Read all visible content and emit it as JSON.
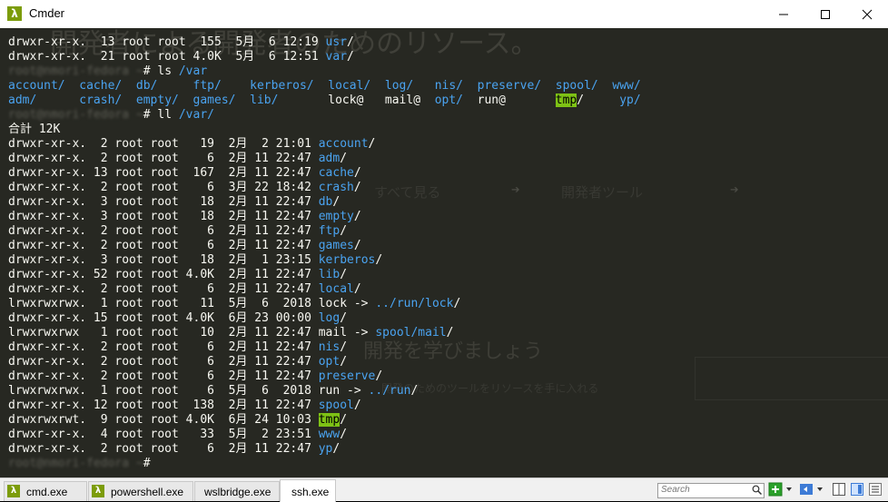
{
  "window": {
    "title": "Cmder"
  },
  "background_ghost": {
    "title": "開発者による開発者のためのリソース。",
    "mid": "開発を学びましょう",
    "menu_left": "すべて見る",
    "menu_right": "開発者ツール",
    "small": "開発のためのツールをリソースを手に入れる"
  },
  "terminal": {
    "lines": [
      [
        {
          "t": "drwxr-xr-x.  13 root root  155  5月  6 12:19 "
        },
        {
          "t": "usr",
          "c": "dir"
        },
        {
          "t": "/"
        }
      ],
      [
        {
          "t": "drwxr-xr-x.  21 root root 4.0K  5月  6 12:51 "
        },
        {
          "t": "var",
          "c": "dir"
        },
        {
          "t": "/"
        }
      ],
      [
        {
          "t": "root@nmori-fedora ",
          "c": "blur"
        },
        {
          "t": "~",
          "c": "blur"
        },
        {
          "t": "# ls "
        },
        {
          "t": "/var",
          "c": "dir"
        }
      ],
      [
        {
          "t": "account/",
          "c": "dir"
        },
        {
          "t": "  "
        },
        {
          "t": "cache/",
          "c": "dir"
        },
        {
          "t": "  "
        },
        {
          "t": "db/",
          "c": "dir"
        },
        {
          "t": "     "
        },
        {
          "t": "ftp/",
          "c": "dir"
        },
        {
          "t": "    "
        },
        {
          "t": "kerberos/",
          "c": "dir"
        },
        {
          "t": "  "
        },
        {
          "t": "local/",
          "c": "dir"
        },
        {
          "t": "  "
        },
        {
          "t": "log/",
          "c": "dir"
        },
        {
          "t": "   "
        },
        {
          "t": "nis/",
          "c": "dir"
        },
        {
          "t": "  "
        },
        {
          "t": "preserve/",
          "c": "dir"
        },
        {
          "t": "  "
        },
        {
          "t": "spool/",
          "c": "dir"
        },
        {
          "t": "  "
        },
        {
          "t": "www/",
          "c": "dir"
        }
      ],
      [
        {
          "t": "adm/",
          "c": "dir"
        },
        {
          "t": "      "
        },
        {
          "t": "crash/",
          "c": "dir"
        },
        {
          "t": "  "
        },
        {
          "t": "empty/",
          "c": "dir"
        },
        {
          "t": "  "
        },
        {
          "t": "games/",
          "c": "dir"
        },
        {
          "t": "  "
        },
        {
          "t": "lib/",
          "c": "dir"
        },
        {
          "t": "       "
        },
        {
          "t": "lock@"
        },
        {
          "t": "   "
        },
        {
          "t": "mail@"
        },
        {
          "t": "  "
        },
        {
          "t": "opt/",
          "c": "dir"
        },
        {
          "t": "  "
        },
        {
          "t": "run@"
        },
        {
          "t": "       "
        },
        {
          "t": "tmp",
          "c": "tmp"
        },
        {
          "t": "/"
        },
        {
          "t": "     "
        },
        {
          "t": "yp/",
          "c": "dir"
        }
      ],
      [
        {
          "t": "root@nmori-fedora ",
          "c": "blur"
        },
        {
          "t": "~",
          "c": "blur"
        },
        {
          "t": "# ll "
        },
        {
          "t": "/var/",
          "c": "dir"
        }
      ],
      [
        {
          "t": "合計 12K"
        }
      ],
      [
        {
          "t": "drwxr-xr-x.  2 root root   19  2月  2 21:01 "
        },
        {
          "t": "account",
          "c": "dir"
        },
        {
          "t": "/"
        }
      ],
      [
        {
          "t": "drwxr-xr-x.  2 root root    6  2月 11 22:47 "
        },
        {
          "t": "adm",
          "c": "dir"
        },
        {
          "t": "/"
        }
      ],
      [
        {
          "t": "drwxr-xr-x. 13 root root  167  2月 11 22:47 "
        },
        {
          "t": "cache",
          "c": "dir"
        },
        {
          "t": "/"
        }
      ],
      [
        {
          "t": "drwxr-xr-x.  2 root root    6  3月 22 18:42 "
        },
        {
          "t": "crash",
          "c": "dir"
        },
        {
          "t": "/"
        }
      ],
      [
        {
          "t": "drwxr-xr-x.  3 root root   18  2月 11 22:47 "
        },
        {
          "t": "db",
          "c": "dir"
        },
        {
          "t": "/"
        }
      ],
      [
        {
          "t": "drwxr-xr-x.  3 root root   18  2月 11 22:47 "
        },
        {
          "t": "empty",
          "c": "dir"
        },
        {
          "t": "/"
        }
      ],
      [
        {
          "t": "drwxr-xr-x.  2 root root    6  2月 11 22:47 "
        },
        {
          "t": "ftp",
          "c": "dir"
        },
        {
          "t": "/"
        }
      ],
      [
        {
          "t": "drwxr-xr-x.  2 root root    6  2月 11 22:47 "
        },
        {
          "t": "games",
          "c": "dir"
        },
        {
          "t": "/"
        }
      ],
      [
        {
          "t": "drwxr-xr-x.  3 root root   18  2月  1 23:15 "
        },
        {
          "t": "kerberos",
          "c": "dir"
        },
        {
          "t": "/"
        }
      ],
      [
        {
          "t": "drwxr-xr-x. 52 root root 4.0K  2月 11 22:47 "
        },
        {
          "t": "lib",
          "c": "dir"
        },
        {
          "t": "/"
        }
      ],
      [
        {
          "t": "drwxr-xr-x.  2 root root    6  2月 11 22:47 "
        },
        {
          "t": "local",
          "c": "dir"
        },
        {
          "t": "/"
        }
      ],
      [
        {
          "t": "lrwxrwxrwx.  1 root root   11  5月  6  2018 lock -> "
        },
        {
          "t": "../run/lock",
          "c": "dir"
        },
        {
          "t": "/"
        }
      ],
      [
        {
          "t": "drwxr-xr-x. 15 root root 4.0K  6月 23 00:00 "
        },
        {
          "t": "log",
          "c": "dir"
        },
        {
          "t": "/"
        }
      ],
      [
        {
          "t": "lrwxrwxrwx   1 root root   10  2月 11 22:47 mail -> "
        },
        {
          "t": "spool/mail",
          "c": "dir"
        },
        {
          "t": "/"
        }
      ],
      [
        {
          "t": "drwxr-xr-x.  2 root root    6  2月 11 22:47 "
        },
        {
          "t": "nis",
          "c": "dir"
        },
        {
          "t": "/"
        }
      ],
      [
        {
          "t": "drwxr-xr-x.  2 root root    6  2月 11 22:47 "
        },
        {
          "t": "opt",
          "c": "dir"
        },
        {
          "t": "/"
        }
      ],
      [
        {
          "t": "drwxr-xr-x.  2 root root    6  2月 11 22:47 "
        },
        {
          "t": "preserve",
          "c": "dir"
        },
        {
          "t": "/"
        }
      ],
      [
        {
          "t": "lrwxrwxrwx.  1 root root    6  5月  6  2018 run -> "
        },
        {
          "t": "../run",
          "c": "dir"
        },
        {
          "t": "/"
        }
      ],
      [
        {
          "t": "drwxr-xr-x. 12 root root  138  2月 11 22:47 "
        },
        {
          "t": "spool",
          "c": "dir"
        },
        {
          "t": "/"
        }
      ],
      [
        {
          "t": "drwxrwxrwt.  9 root root 4.0K  6月 24 10:03 "
        },
        {
          "t": "tmp",
          "c": "tmp"
        },
        {
          "t": "/"
        }
      ],
      [
        {
          "t": "drwxr-xr-x.  4 root root   33  5月  2 23:51 "
        },
        {
          "t": "www",
          "c": "dir"
        },
        {
          "t": "/"
        }
      ],
      [
        {
          "t": "drwxr-xr-x.  2 root root    6  2月 11 22:47 "
        },
        {
          "t": "yp",
          "c": "dir"
        },
        {
          "t": "/"
        }
      ],
      [
        {
          "t": "root@nmori-fedora ",
          "c": "blur"
        },
        {
          "t": "~",
          "c": "blur"
        },
        {
          "t": "# "
        }
      ]
    ]
  },
  "tabs": [
    {
      "label": "cmd.exe"
    },
    {
      "label": "powershell.exe"
    },
    {
      "label": "wslbridge.exe"
    },
    {
      "label": "ssh.exe"
    }
  ],
  "search": {
    "placeholder": "Search"
  },
  "icons": {
    "app": "lambda-icon",
    "minimize": "minimize-icon",
    "maximize": "maximize-icon",
    "close": "close-icon",
    "new_console": "plus-icon",
    "search": "magnifier-icon"
  },
  "colors": {
    "dir": "#4aa3f0",
    "tmp_bg": "#7ec215",
    "bg": "#272822",
    "text": "#f8f8f2"
  }
}
